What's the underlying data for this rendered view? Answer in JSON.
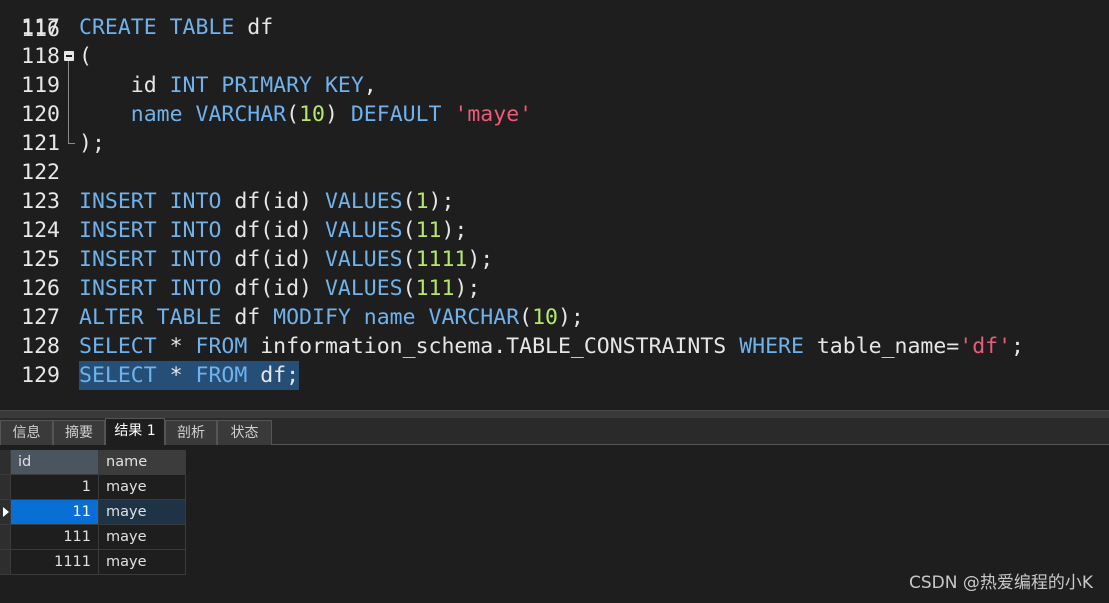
{
  "editor": {
    "first_partial_line": "116",
    "lines": [
      {
        "num": "117",
        "tokens": [
          {
            "t": "CREATE TABLE",
            "c": "kw"
          },
          {
            "t": " df",
            "c": ""
          }
        ]
      },
      {
        "num": "118",
        "tokens": [
          {
            "t": "(",
            "c": ""
          }
        ]
      },
      {
        "num": "119",
        "tokens": [
          {
            "t": "    id ",
            "c": ""
          },
          {
            "t": "INT PRIMARY KEY",
            "c": "kw"
          },
          {
            "t": ",",
            "c": ""
          }
        ]
      },
      {
        "num": "120",
        "tokens": [
          {
            "t": "    ",
            "c": ""
          },
          {
            "t": "name",
            "c": "kw"
          },
          {
            "t": " ",
            "c": ""
          },
          {
            "t": "VARCHAR",
            "c": "kw"
          },
          {
            "t": "(",
            "c": ""
          },
          {
            "t": "10",
            "c": "num"
          },
          {
            "t": ") ",
            "c": ""
          },
          {
            "t": "DEFAULT",
            "c": "kw"
          },
          {
            "t": " ",
            "c": ""
          },
          {
            "t": "'maye'",
            "c": "str"
          }
        ]
      },
      {
        "num": "121",
        "tokens": [
          {
            "t": ");",
            "c": ""
          }
        ]
      },
      {
        "num": "122",
        "tokens": []
      },
      {
        "num": "123",
        "tokens": [
          {
            "t": "INSERT INTO",
            "c": "kw"
          },
          {
            "t": " df(id) ",
            "c": ""
          },
          {
            "t": "VALUES",
            "c": "kw"
          },
          {
            "t": "(",
            "c": ""
          },
          {
            "t": "1",
            "c": "num"
          },
          {
            "t": ");",
            "c": ""
          }
        ]
      },
      {
        "num": "124",
        "tokens": [
          {
            "t": "INSERT INTO",
            "c": "kw"
          },
          {
            "t": " df(id) ",
            "c": ""
          },
          {
            "t": "VALUES",
            "c": "kw"
          },
          {
            "t": "(",
            "c": ""
          },
          {
            "t": "11",
            "c": "num"
          },
          {
            "t": ");",
            "c": ""
          }
        ]
      },
      {
        "num": "125",
        "tokens": [
          {
            "t": "INSERT INTO",
            "c": "kw"
          },
          {
            "t": " df(id) ",
            "c": ""
          },
          {
            "t": "VALUES",
            "c": "kw"
          },
          {
            "t": "(",
            "c": ""
          },
          {
            "t": "1111",
            "c": "num"
          },
          {
            "t": ");",
            "c": ""
          }
        ]
      },
      {
        "num": "126",
        "tokens": [
          {
            "t": "INSERT INTO",
            "c": "kw"
          },
          {
            "t": " df(id) ",
            "c": ""
          },
          {
            "t": "VALUES",
            "c": "kw"
          },
          {
            "t": "(",
            "c": ""
          },
          {
            "t": "111",
            "c": "num"
          },
          {
            "t": ");",
            "c": ""
          }
        ]
      },
      {
        "num": "127",
        "tokens": [
          {
            "t": "ALTER TABLE",
            "c": "kw"
          },
          {
            "t": " df ",
            "c": ""
          },
          {
            "t": "MODIFY",
            "c": "kw"
          },
          {
            "t": " ",
            "c": ""
          },
          {
            "t": "name",
            "c": "kw"
          },
          {
            "t": " ",
            "c": ""
          },
          {
            "t": "VARCHAR",
            "c": "kw"
          },
          {
            "t": "(",
            "c": ""
          },
          {
            "t": "10",
            "c": "num"
          },
          {
            "t": ");",
            "c": ""
          }
        ]
      },
      {
        "num": "128",
        "tokens": [
          {
            "t": "SELECT",
            "c": "kw"
          },
          {
            "t": " * ",
            "c": ""
          },
          {
            "t": "FROM",
            "c": "kw"
          },
          {
            "t": " information_schema.TABLE_CONSTRAINTS ",
            "c": ""
          },
          {
            "t": "WHERE",
            "c": "kw"
          },
          {
            "t": " table_name=",
            "c": ""
          },
          {
            "t": "'df'",
            "c": "str"
          },
          {
            "t": ";",
            "c": ""
          }
        ]
      },
      {
        "num": "129",
        "selected": true,
        "tokens": [
          {
            "t": "SELECT",
            "c": "kw"
          },
          {
            "t": " * ",
            "c": ""
          },
          {
            "t": "FROM",
            "c": "kw"
          },
          {
            "t": " df;",
            "c": ""
          }
        ]
      }
    ]
  },
  "tabs": [
    "信息",
    "摘要",
    "结果 1",
    "剖析",
    "状态"
  ],
  "active_tab": "结果 1",
  "grid": {
    "columns": [
      "id",
      "name"
    ],
    "rows": [
      [
        "1",
        "maye"
      ],
      [
        "11",
        "maye"
      ],
      [
        "111",
        "maye"
      ],
      [
        "1111",
        "maye"
      ]
    ],
    "selected_row": 1
  },
  "watermark": "CSDN @热爱编程的小K",
  "colors": {
    "keyword": "#6fb2ec",
    "number": "#b5e86a",
    "string": "#f05a7a",
    "selection": "#264f78",
    "row_highlight": "#0a6fd4"
  }
}
